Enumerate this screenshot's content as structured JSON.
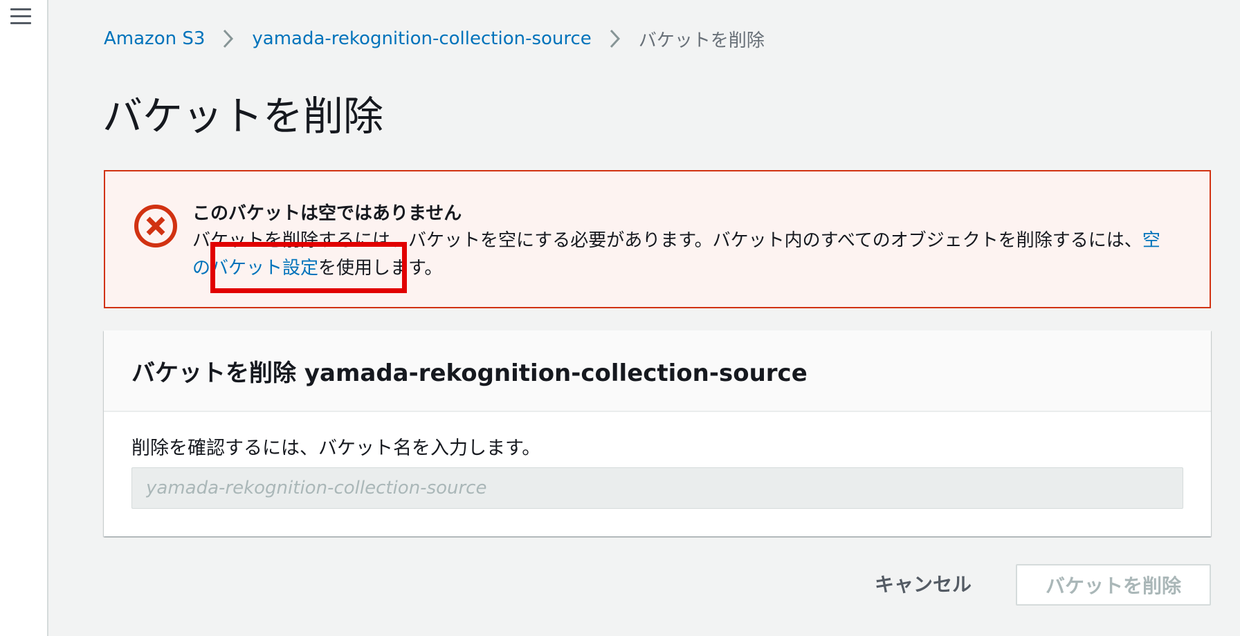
{
  "breadcrumb": {
    "items": [
      "Amazon S3",
      "yamada-rekognition-collection-source"
    ],
    "current": "バケットを削除"
  },
  "page": {
    "title": "バケットを削除"
  },
  "alert": {
    "title": "このバケットは空ではありません",
    "body_before": "バケットを削除するには、バケットを空にする必要があります。バケット内のすべてのオブジェクトを削除するには、",
    "link": "空のバケット設定",
    "body_after": "を使用します。",
    "color": "#d13212"
  },
  "panel": {
    "header": "バケットを削除 yamada-rekognition-collection-source",
    "label": "削除を確認するには、バケット名を入力します。",
    "input_value": "",
    "input_placeholder": "yamada-rekognition-collection-source"
  },
  "actions": {
    "cancel": "キャンセル",
    "delete": "バケットを削除"
  },
  "colors": {
    "link": "#0073bb",
    "highlight": "#e10000"
  }
}
